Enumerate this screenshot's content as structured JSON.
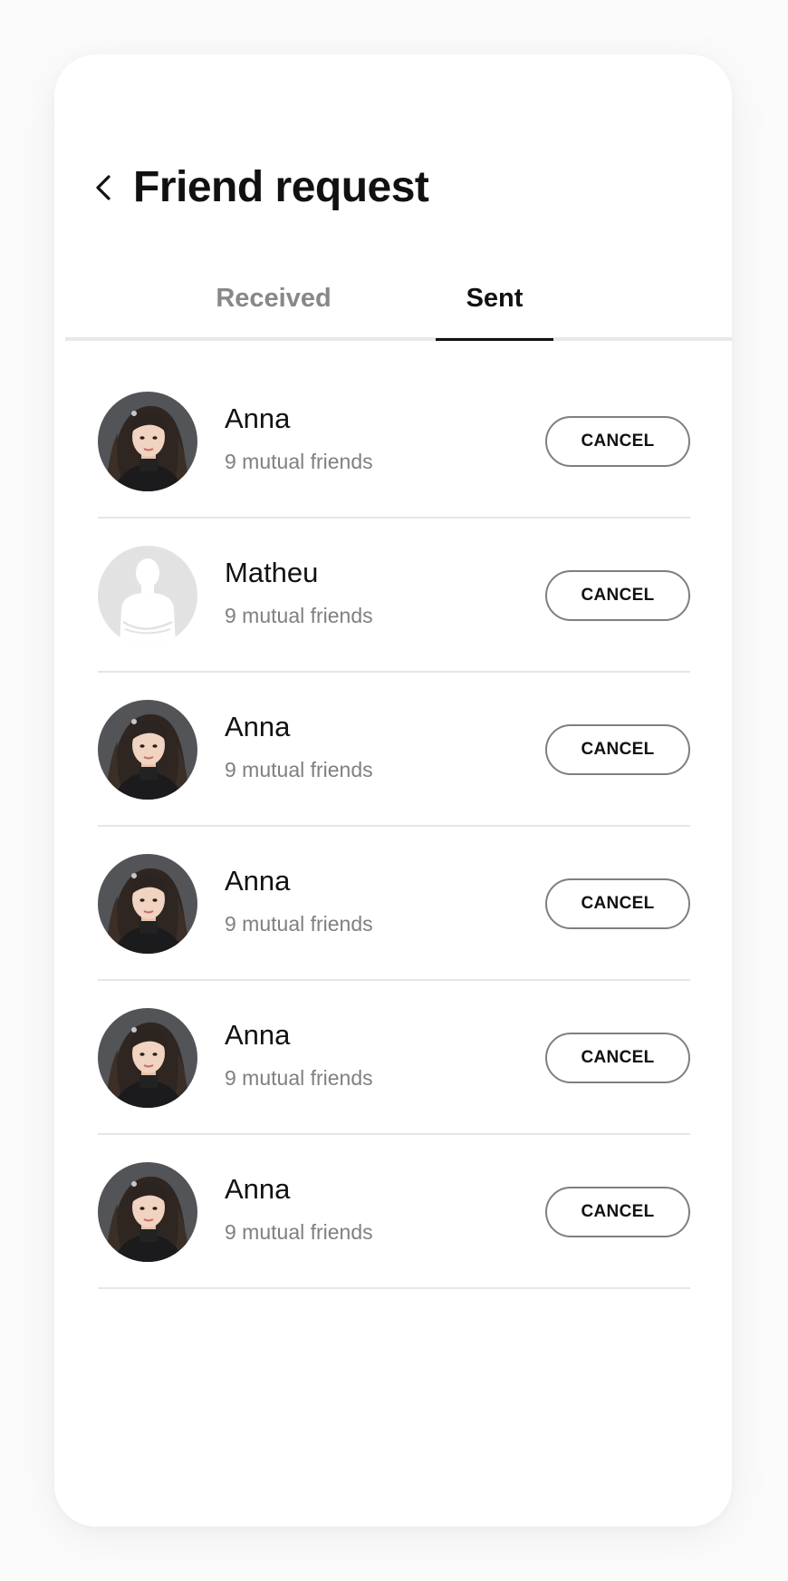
{
  "header": {
    "title": "Friend request",
    "back_icon": "chevron-left-icon"
  },
  "tabs": [
    {
      "label": "Received",
      "active": false
    },
    {
      "label": "Sent",
      "active": true
    }
  ],
  "requests": [
    {
      "name": "Anna",
      "mutual": "9 mutual friends",
      "avatar": "photo",
      "action": "CANCEL"
    },
    {
      "name": "Matheu",
      "mutual": "9 mutual friends",
      "avatar": "placeholder",
      "action": "CANCEL"
    },
    {
      "name": "Anna",
      "mutual": "9 mutual friends",
      "avatar": "photo",
      "action": "CANCEL"
    },
    {
      "name": "Anna",
      "mutual": "9 mutual friends",
      "avatar": "photo",
      "action": "CANCEL"
    },
    {
      "name": "Anna",
      "mutual": "9 mutual friends",
      "avatar": "photo",
      "action": "CANCEL"
    },
    {
      "name": "Anna",
      "mutual": "9 mutual friends",
      "avatar": "photo",
      "action": "CANCEL"
    }
  ],
  "colors": {
    "text_primary": "#111111",
    "text_secondary": "#808080",
    "tab_inactive": "#888888",
    "divider": "#e6e6e6",
    "button_border": "#7f7f7f"
  }
}
